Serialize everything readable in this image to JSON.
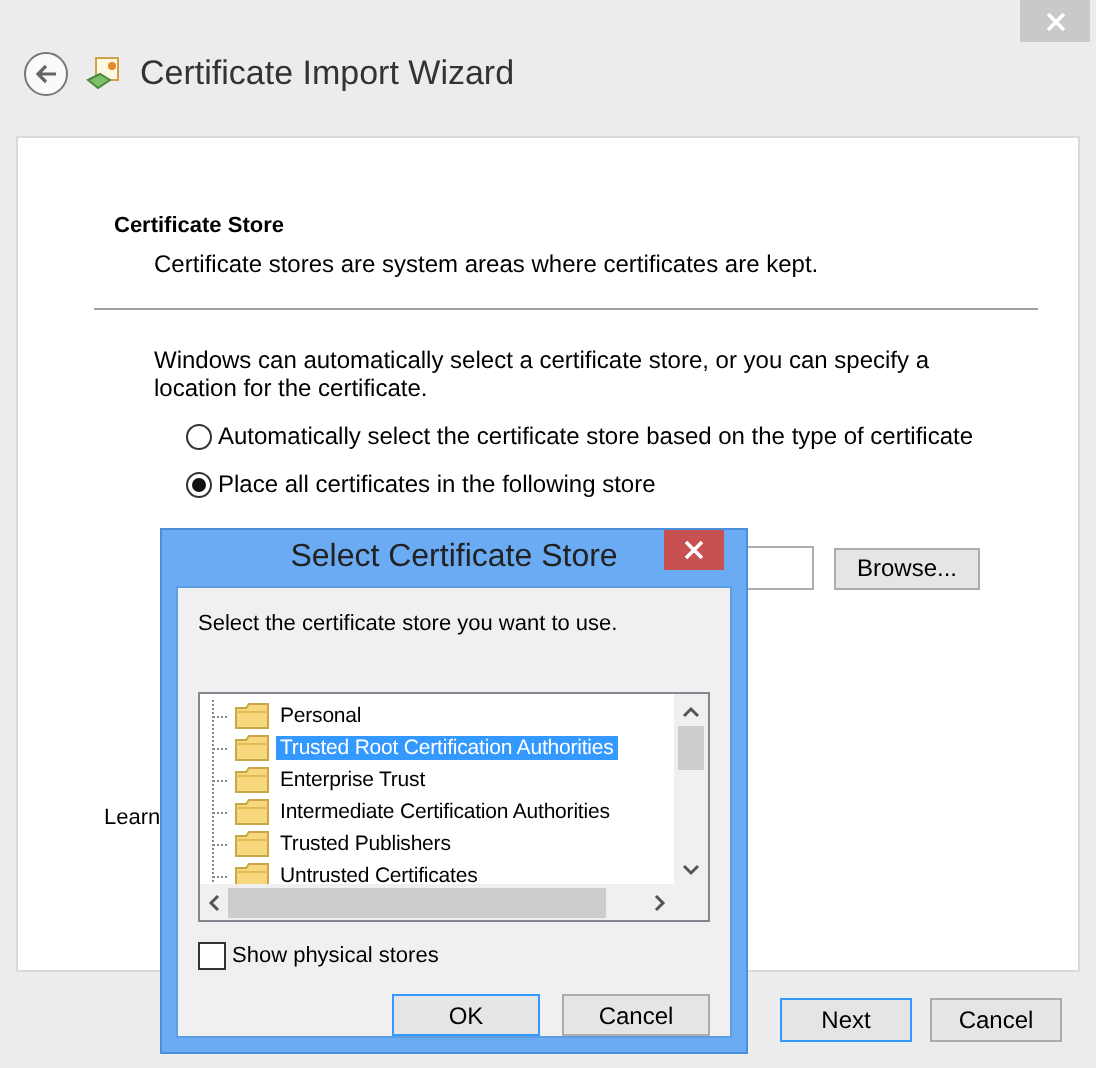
{
  "window": {
    "title": "Certificate Import Wizard"
  },
  "page": {
    "heading": "Certificate Store",
    "description": "Certificate stores are system areas where certificates are kept.",
    "intro": "Windows can automatically select a certificate store, or you can specify a location for the certificate.",
    "options": [
      {
        "label": "Automatically select the certificate store based on the type of certificate",
        "selected": false
      },
      {
        "label": "Place all certificates in the following store",
        "selected": true
      }
    ],
    "browse_button": "Browse...",
    "learn_link": "Learn"
  },
  "buttons": [
    {
      "label": "Next",
      "default": true
    },
    {
      "label": "Cancel",
      "default": false
    }
  ],
  "dialog": {
    "title": "Select Certificate Store",
    "prompt": "Select the certificate store you want to use.",
    "stores": [
      {
        "label": "Personal",
        "selected": false
      },
      {
        "label": "Trusted Root Certification Authorities",
        "selected": true
      },
      {
        "label": "Enterprise Trust",
        "selected": false
      },
      {
        "label": "Intermediate Certification Authorities",
        "selected": false
      },
      {
        "label": "Trusted Publishers",
        "selected": false
      },
      {
        "label": "Untrusted Certificates",
        "selected": false
      }
    ],
    "show_physical": {
      "label": "Show physical stores",
      "checked": false
    },
    "buttons": [
      {
        "label": "OK",
        "default": true
      },
      {
        "label": "Cancel",
        "default": false
      }
    ]
  }
}
